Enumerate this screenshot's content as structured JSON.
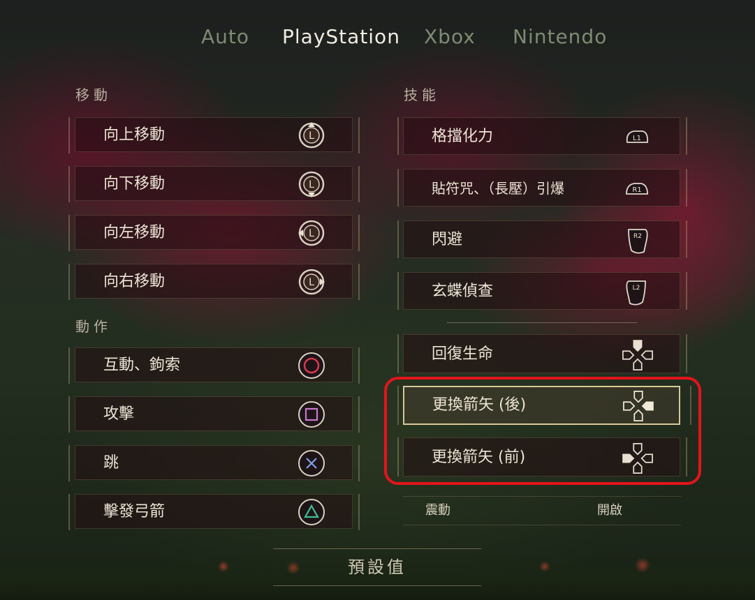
{
  "tabs": [
    "Auto",
    "PlayStation",
    "Xbox",
    "Nintendo"
  ],
  "active_tab": "PlayStation",
  "sections": {
    "movement": {
      "title": "移動",
      "items": [
        {
          "label": "向上移動",
          "icon": "left-stick-up-icon"
        },
        {
          "label": "向下移動",
          "icon": "left-stick-down-icon"
        },
        {
          "label": "向左移動",
          "icon": "left-stick-left-icon"
        },
        {
          "label": "向右移動",
          "icon": "left-stick-right-icon"
        }
      ]
    },
    "actions": {
      "title": "動作",
      "items": [
        {
          "label": "互動、鉤索",
          "icon": "circle-button-icon"
        },
        {
          "label": "攻擊",
          "icon": "square-button-icon"
        },
        {
          "label": "跳",
          "icon": "cross-button-icon"
        },
        {
          "label": "擊發弓箭",
          "icon": "triangle-button-icon"
        }
      ]
    },
    "skills": {
      "title": "技能",
      "items": [
        {
          "label": "格擋化力",
          "icon": "l1-button-icon",
          "glyph": "L1"
        },
        {
          "label": "貼符咒、（長壓）引爆",
          "icon": "r1-button-icon",
          "glyph": "R1"
        },
        {
          "label": "閃避",
          "icon": "r2-button-icon",
          "glyph": "R2"
        },
        {
          "label": "玄蝶偵查",
          "icon": "l2-button-icon",
          "glyph": "L2"
        }
      ]
    },
    "dpad": {
      "items": [
        {
          "label": "回復生命",
          "icon": "dpad-up-icon"
        },
        {
          "label": "更換箭矢 (後)",
          "icon": "dpad-right-icon",
          "selected": true
        },
        {
          "label": "更換箭矢 (前)",
          "icon": "dpad-left-icon"
        }
      ]
    }
  },
  "stick_letter": "L",
  "vibration": {
    "label": "震動",
    "value": "開啟"
  },
  "defaults_button": "預設值",
  "colors": {
    "circle": "#d63a4a",
    "square": "#c77ac9",
    "cross": "#7f9fe0",
    "triangle": "#3fbf95",
    "highlight": "#e3141c"
  }
}
